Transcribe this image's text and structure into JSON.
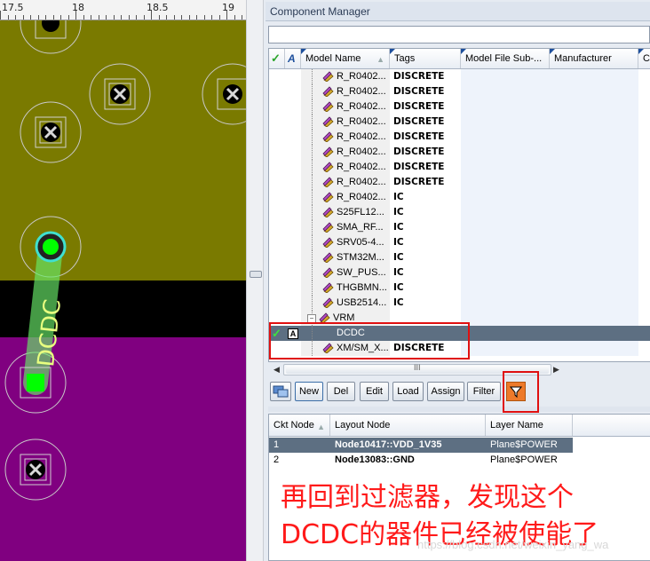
{
  "ruler": {
    "labels": [
      "17.5",
      "18",
      "18.5",
      "19"
    ]
  },
  "pcb": {
    "net_label": "DCDC"
  },
  "panel": {
    "title": "Component Manager"
  },
  "grid": {
    "columns": [
      "Model Name",
      "Tags",
      "Model File Sub-...",
      "Manufacturer",
      "Ca"
    ],
    "rows": [
      {
        "name": "R_R0402...",
        "tag": "DISCRETE"
      },
      {
        "name": "R_R0402...",
        "tag": "DISCRETE"
      },
      {
        "name": "R_R0402...",
        "tag": "DISCRETE"
      },
      {
        "name": "R_R0402...",
        "tag": "DISCRETE"
      },
      {
        "name": "R_R0402...",
        "tag": "DISCRETE"
      },
      {
        "name": "R_R0402...",
        "tag": "DISCRETE"
      },
      {
        "name": "R_R0402...",
        "tag": "DISCRETE"
      },
      {
        "name": "R_R0402...",
        "tag": "DISCRETE"
      },
      {
        "name": "R_R0402...",
        "tag": "IC"
      },
      {
        "name": "S25FL12...",
        "tag": "IC"
      },
      {
        "name": "SMA_RF...",
        "tag": "IC"
      },
      {
        "name": "SRV05-4...",
        "tag": "IC"
      },
      {
        "name": "STM32M...",
        "tag": "IC"
      },
      {
        "name": "SW_PUS...",
        "tag": "IC"
      },
      {
        "name": "THGBMN...",
        "tag": "IC"
      },
      {
        "name": "USB2514...",
        "tag": "IC"
      },
      {
        "name": "VRM",
        "tag": ""
      },
      {
        "name": "DCDC",
        "tag": ""
      },
      {
        "name": "XM/SM_X...",
        "tag": "DISCRETE"
      }
    ],
    "checkbox_letter": "A"
  },
  "scroll": {
    "thumb_glyph": "III"
  },
  "toolbar": {
    "new": "New",
    "del": "Del",
    "edit": "Edit",
    "load": "Load",
    "assign": "Assign",
    "filter": "Filter"
  },
  "nodes": {
    "columns": [
      "Ckt Node",
      "Layout Node",
      "Layer Name"
    ],
    "rows": [
      {
        "ckt": "1",
        "layout": "Node10417::VDD_1V35",
        "layer": "Plane$POWER"
      },
      {
        "ckt": "2",
        "layout": "Node13083::GND",
        "layer": "Plane$POWER"
      }
    ]
  },
  "annotation": {
    "line1": "再回到过滤器，发现这个",
    "line2": "DCDC的器件已经被使能了"
  },
  "watermark": "https://blog.csdn.net/weixin_yang_wa",
  "colors": {
    "selection": "#5d6f82",
    "annotation": "#ff1a1a",
    "filter_active": "#ee7a2a"
  }
}
